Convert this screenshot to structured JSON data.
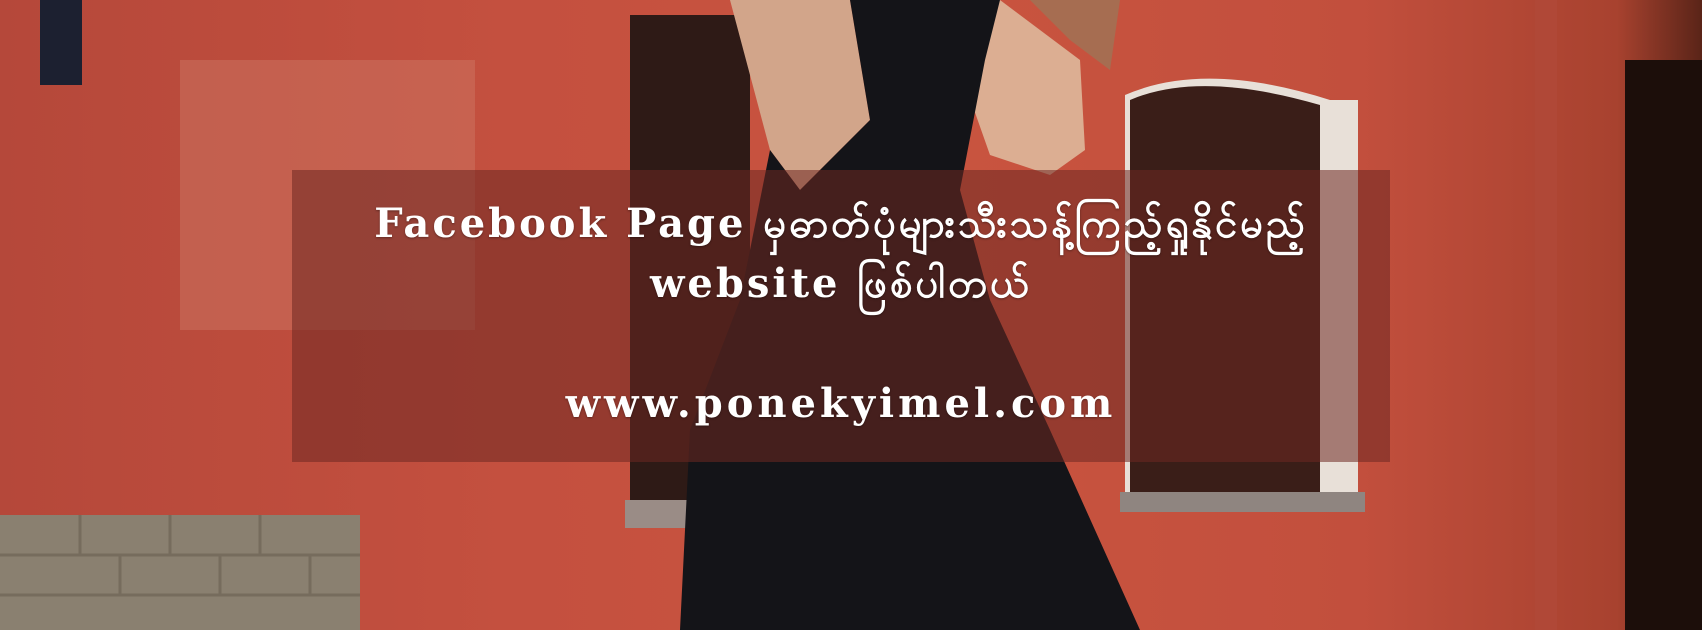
{
  "banner": {
    "headline_line1": "Facebook Page မှဓာတ်ပုံများသီးသန့်ကြည့်ရှုနိုင်မည့်",
    "headline_line2": "website ဖြစ်ပါတယ်",
    "url": "www.ponekyimel.com"
  },
  "colors": {
    "wall": "#c4503f",
    "overlay": "#6e2822",
    "text": "#ffffff",
    "dress": "#141418"
  }
}
